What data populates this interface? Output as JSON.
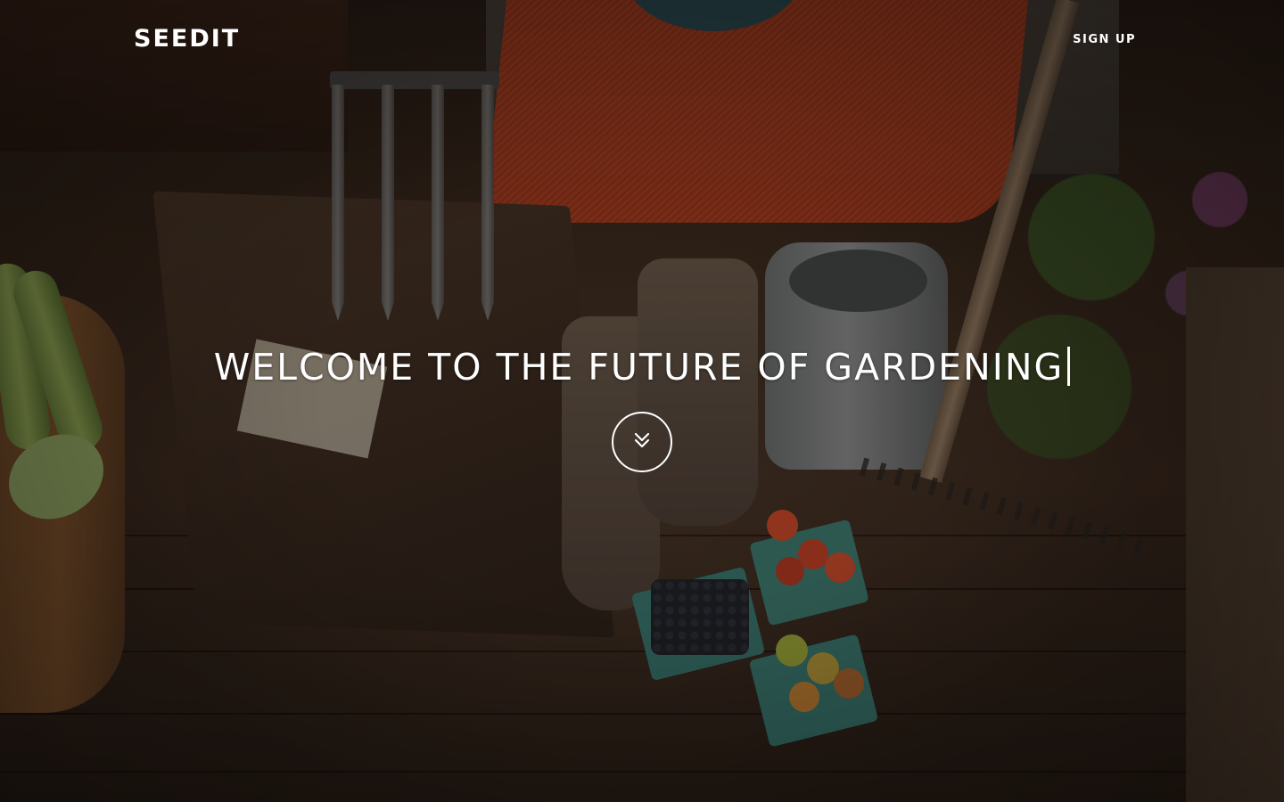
{
  "header": {
    "brand": "SEEDIT",
    "signup_label": "SIGN UP"
  },
  "hero": {
    "headline": "WELCOME TO THE FUTURE OF GARDENING",
    "scroll_icon": "chevron-double-down-icon"
  },
  "colors": {
    "text": "#ffffff",
    "overlay": "#1b140f"
  }
}
